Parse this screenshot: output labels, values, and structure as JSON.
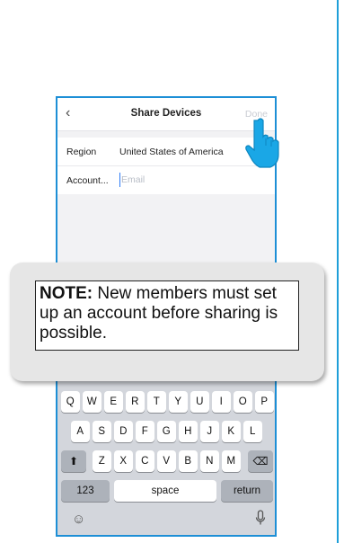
{
  "navbar": {
    "back_icon": "chevron-left-icon",
    "title": "Share Devices",
    "done_label": "Done"
  },
  "form": {
    "region_label": "Region",
    "region_value": "United States of America",
    "account_label": "Account...",
    "account_placeholder": "Email"
  },
  "keyboard": {
    "row1": [
      "Q",
      "W",
      "E",
      "R",
      "T",
      "Y",
      "U",
      "I",
      "O",
      "P"
    ],
    "row2": [
      "A",
      "S",
      "D",
      "F",
      "G",
      "H",
      "J",
      "K",
      "L"
    ],
    "row3": [
      "Z",
      "X",
      "C",
      "V",
      "B",
      "N",
      "M"
    ],
    "numbers_label": "123",
    "space_label": "space",
    "return_label": "return",
    "shift_icon": "shift-icon",
    "delete_icon": "backspace-icon",
    "emoji_icon": "emoji-icon",
    "mic_icon": "microphone-icon"
  },
  "note": {
    "heading": "NOTE:",
    "text": " New members must set up an account before sharing is possible."
  },
  "colors": {
    "frame": "#1d8fd6",
    "rule": "#1f9fd9",
    "hand": "#1aa7e6"
  }
}
